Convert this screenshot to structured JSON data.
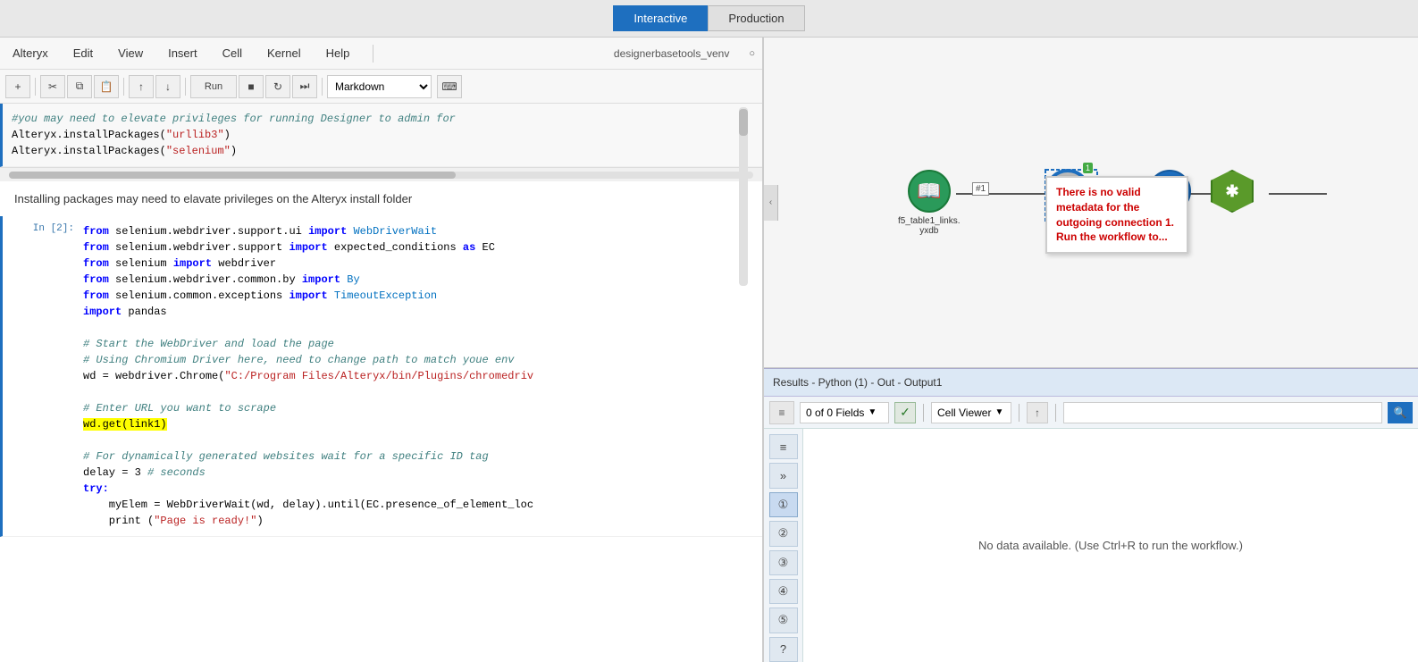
{
  "topbar": {
    "interactive_label": "Interactive",
    "production_label": "Production"
  },
  "jupyter": {
    "menu": {
      "alteryx": "Alteryx",
      "edit": "Edit",
      "view": "View",
      "insert": "Insert",
      "cell": "Cell",
      "kernel": "Kernel",
      "help": "Help",
      "env": "designerbasetools_venv"
    },
    "toolbar": {
      "add": "+",
      "cut": "✂",
      "copy": "⧉",
      "paste": "⬛",
      "up": "↑",
      "down": "↓",
      "run": "Run",
      "stop": "■",
      "refresh": "↻",
      "fast_forward": "⏭",
      "cell_type": "Markdown"
    },
    "code_comment": "#you may need to elevate privileges for running Designer to admin for",
    "code_lines": [
      "Alteryx.installPackages(\"urllib3\")",
      "Alteryx.installPackages(\"selenium\")"
    ],
    "install_msg": "Installing packages may need to elavate privileges on the Alteryx install folder",
    "cell2_label": "In [2]:",
    "cell2_code": [
      "from selenium.webdriver.support.ui import WebDriverWait",
      "from selenium.webdriver.support import expected_conditions as EC",
      "from selenium import webdriver",
      "from selenium.webdriver.common.by import By",
      "from selenium.common.exceptions import TimeoutException",
      "import pandas",
      "",
      "# Start the WebDriver and load the page",
      "# Using Chromium Driver here, need to change path to match youe env",
      "wd = webdriver.Chrome(\"C:/Program Files/Alteryx/bin/Plugins/chromedriv",
      "",
      "# Enter URL you want to scrape",
      "wd.get(link1)",
      "",
      "# For dynamically generated websites wait for a specific ID tag",
      "delay = 3 # seconds",
      "try:",
      "    myElem = WebDriverWait(wd, delay).until(EC.presence_of_element_loc",
      "    print (\"Page is ready!\")"
    ]
  },
  "workflow": {
    "error_tooltip": "There is no valid metadata for the outgoing connection 1. Run the workflow to...",
    "node1_label": "f5_table1_links.\nyxdb",
    "node1_color": "#2e8b57",
    "node2_color": "#aaaaaa",
    "node3_color": "#1e6fbf",
    "node4_color": "#5a9a2a"
  },
  "results": {
    "header": "Results - Python (1) - Out - Output1",
    "fields_label": "0 of 0 Fields",
    "check_symbol": "✓",
    "viewer_label": "Cell Viewer",
    "up_symbol": "↑",
    "search_placeholder": "",
    "no_data_msg": "No data available. (Use Ctrl+R to run the workflow.)",
    "sidebar_icons": [
      "≡",
      "»",
      "①",
      "②",
      "③",
      "④",
      "⑤",
      "?"
    ]
  },
  "colors": {
    "active_tab": "#1e6fbf",
    "results_header_bg": "#dce8f5",
    "node1_bg": "#2e7d4e",
    "node2_bg": "#888888",
    "node3_bg": "#1e6fbf",
    "node4_bg": "#5a9a2a",
    "error_red": "#cc0000"
  }
}
